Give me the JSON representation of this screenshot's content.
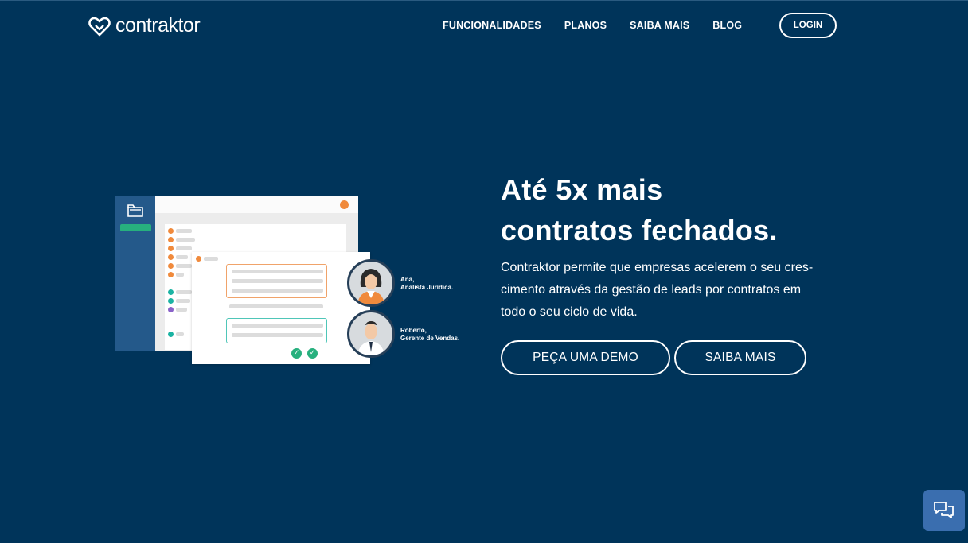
{
  "brand": {
    "name": "contraktor"
  },
  "nav": {
    "items": [
      "FUNCIONALIDADES",
      "PLANOS",
      "SAIBA MAIS",
      "BLOG"
    ],
    "login": "LOGIN"
  },
  "hero": {
    "headline_line1": "Até 5x mais",
    "headline_line2": "contratos fechados.",
    "subtext_line1": "Contraktor permite que empresas acelerem o seu cres-",
    "subtext_line2": "cimento através da gestão de leads por contratos em",
    "subtext_line3": "todo o seu ciclo de vida.",
    "cta_primary": "PEÇA UMA DEMO",
    "cta_secondary": "SAIBA MAIS"
  },
  "illustration": {
    "person1_name": "Ana,",
    "person1_role": "Analista Jurídica.",
    "person2_name": "Roberto,",
    "person2_role": "Gerente de Vendas."
  },
  "icons": {
    "logo": "handshake-heart-icon",
    "folder": "folder-icon",
    "check": "check-icon",
    "chat": "chat-bubbles-icon"
  },
  "colors": {
    "background": "#00345a",
    "sidebar": "#24598a",
    "accent_green": "#27b07e",
    "accent_orange": "#f08a3c",
    "accent_teal": "#1bb3a3",
    "accent_purple": "#8a63c9",
    "chat_button": "#3a6eaf"
  }
}
